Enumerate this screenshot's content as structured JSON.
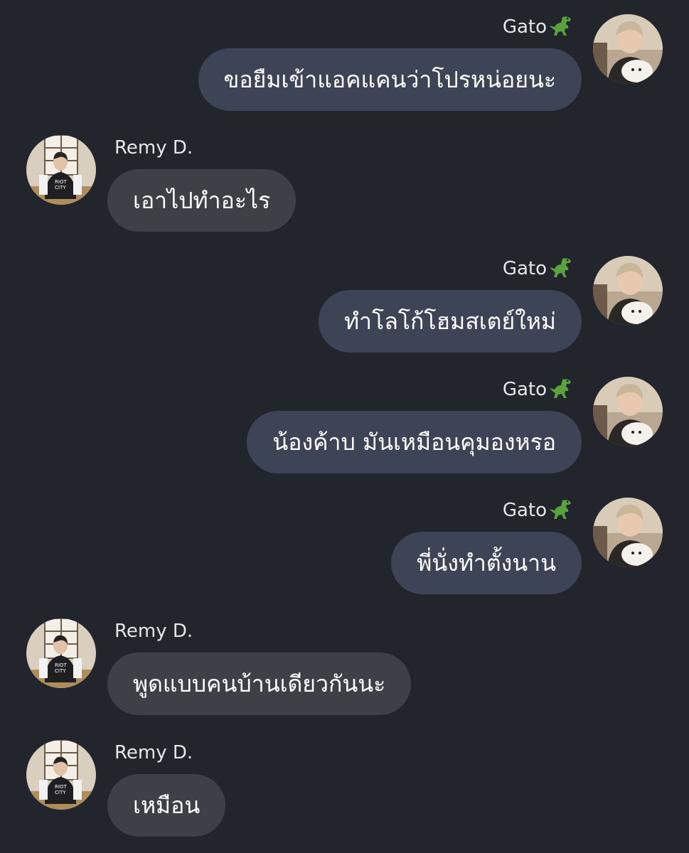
{
  "chat": {
    "users": {
      "gato": {
        "name": "Gato",
        "emoji": "🦖"
      },
      "remy": {
        "name": "Remy D."
      }
    },
    "messages": [
      {
        "sender": "gato",
        "text": "ขอยืมเข้าแอคแคนว่าโปรหน่อยนะ"
      },
      {
        "sender": "remy",
        "text": "เอาไปทำอะไร"
      },
      {
        "sender": "gato",
        "text": "ทำโลโก้โฮมสเตย์ใหม่"
      },
      {
        "sender": "gato",
        "text": "น้องค้าบ มันเหมือนคุมองหรอ"
      },
      {
        "sender": "gato",
        "text": "พี่นั่งทำตั้งนาน"
      },
      {
        "sender": "remy",
        "text": "พูดแบบคนบ้านเดียวกันนะ"
      },
      {
        "sender": "remy",
        "text": "เหมือน"
      }
    ]
  },
  "colors": {
    "background": "#23252d",
    "outgoing_bubble": "#3d4455",
    "incoming_bubble": "#3e4048",
    "text": "#ffffff"
  }
}
